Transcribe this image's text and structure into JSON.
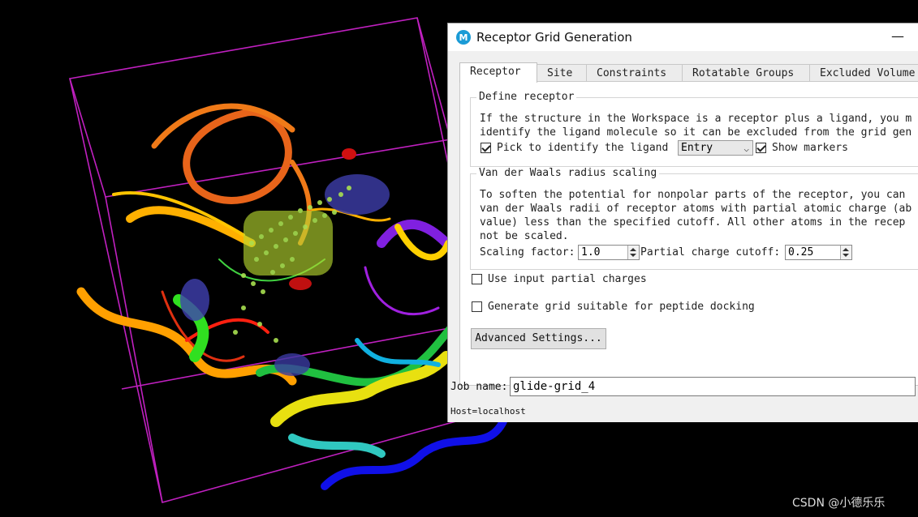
{
  "dialog": {
    "logo_letter": "M",
    "title": "Receptor Grid Generation",
    "minimize_glyph": "—"
  },
  "tabs": [
    {
      "label": "Receptor",
      "active": true
    },
    {
      "label": "Site",
      "active": false
    },
    {
      "label": "Constraints",
      "active": false
    },
    {
      "label": "Rotatable Groups",
      "active": false
    },
    {
      "label": "Excluded Volume",
      "active": false
    }
  ],
  "define_receptor": {
    "title": "Define receptor",
    "text_line1": "If the structure in the Workspace is a receptor plus a ligand, you m",
    "text_line2": "identify the ligand molecule so it can be excluded from the grid gen",
    "pick_label": "Pick to identify the ligand",
    "pick_checked": true,
    "pick_mode_value": "Entry",
    "show_markers_label": "Show markers",
    "show_markers_checked": true
  },
  "vdw": {
    "title": "Van der Waals radius scaling",
    "line1": "To soften the potential for nonpolar parts of the receptor, you can",
    "line2": "van der Waals radii of receptor atoms with partial atomic charge (ab",
    "line3": "value) less than the specified cutoff.  All other atoms in the recep",
    "line4": "not be scaled.",
    "scaling_label": "Scaling factor:",
    "scaling_value": "1.0",
    "cutoff_label": "Partial charge cutoff:",
    "cutoff_value": "0.25"
  },
  "options": {
    "use_partial_label": "Use input partial charges",
    "use_partial_checked": false,
    "peptide_label": "Generate grid suitable for peptide docking",
    "peptide_checked": false
  },
  "advanced_button": "Advanced Settings...",
  "job": {
    "label": "Job name:",
    "value": "glide-grid_4",
    "host": "Host=localhost"
  },
  "watermark": "CSDN @小德乐乐",
  "colors": {
    "grid_box": "#c020c0",
    "accent": "#1a9bd6"
  }
}
